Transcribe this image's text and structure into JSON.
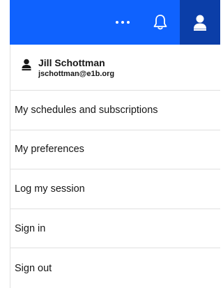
{
  "header": {
    "background_color": "#0f62fe",
    "active_button_color": "#0b3ea8",
    "more_icon": "overflow-menu-icon",
    "notification_icon": "bell-icon",
    "user_icon": "user-avatar-icon"
  },
  "profile": {
    "icon": "user-icon",
    "name": "Jill Schottman",
    "email": "jschottman@e1b.org"
  },
  "menu": {
    "items": [
      {
        "label": "My schedules and subscriptions"
      },
      {
        "label": "My preferences"
      },
      {
        "label": "Log my session"
      },
      {
        "label": "Sign in"
      },
      {
        "label": "Sign out"
      }
    ]
  }
}
